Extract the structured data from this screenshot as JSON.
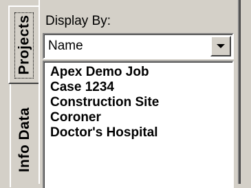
{
  "tabs": [
    {
      "label": "Projects",
      "selected": true
    },
    {
      "label": "Info Data",
      "selected": false
    }
  ],
  "display_by": {
    "label": "Display By:",
    "selected_value": "Name",
    "dropdown_icon": "chevron-down-icon"
  },
  "projects_list": {
    "items": [
      "Apex Demo Job",
      "Case 1234",
      "Construction Site",
      "Coroner",
      "Doctor's Hospital"
    ]
  },
  "colors": {
    "face": "#d4d0c8",
    "highlight": "#ffffff",
    "shadow": "#808080",
    "dark_shadow": "#404040"
  }
}
